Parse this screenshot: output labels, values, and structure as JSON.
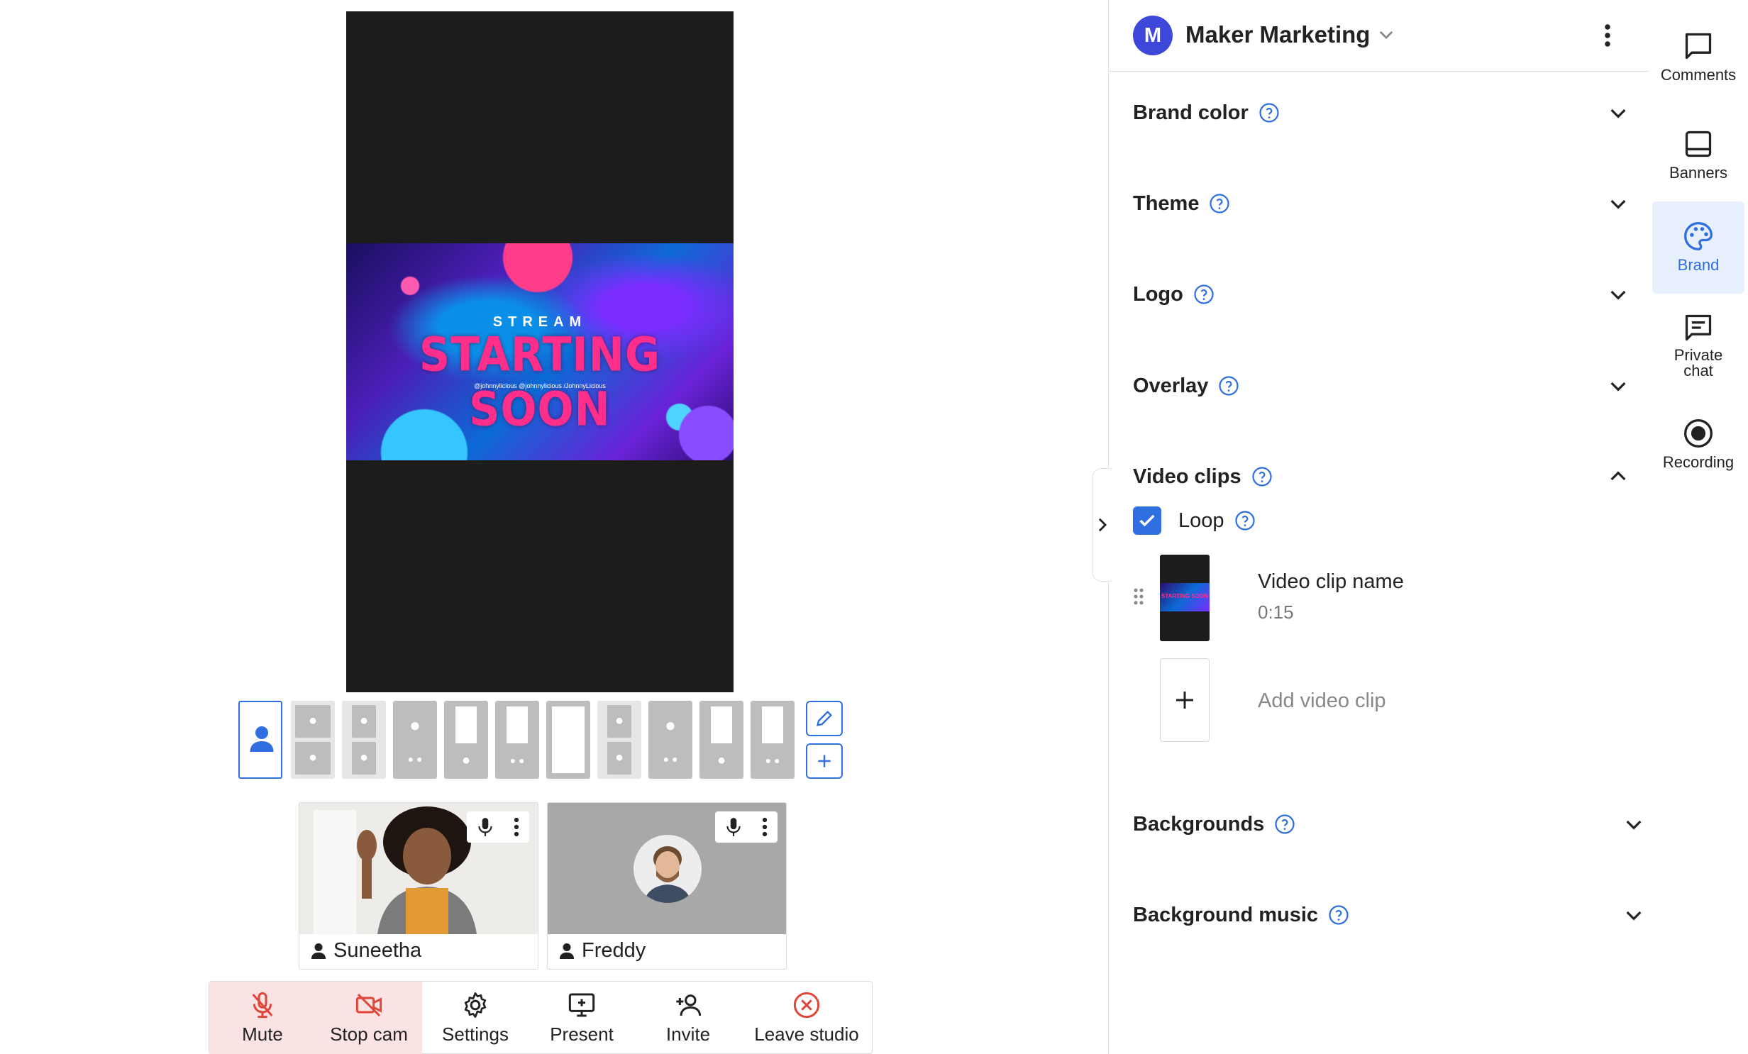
{
  "stage": {
    "banner_small": "STREAM",
    "banner_big": "STARTING SOON",
    "banner_handles": "@johnnylicious   @johnnylicious   /JohnnyLicious"
  },
  "participants": [
    {
      "name": "Suneetha"
    },
    {
      "name": "Freddy"
    }
  ],
  "controls": {
    "mute": "Mute",
    "stop_cam": "Stop cam",
    "settings": "Settings",
    "present": "Present",
    "invite": "Invite",
    "leave": "Leave studio"
  },
  "panel": {
    "brand_initial": "M",
    "brand_name": "Maker Marketing",
    "sections": {
      "brand_color": "Brand color",
      "theme": "Theme",
      "logo": "Logo",
      "overlay": "Overlay",
      "video_clips": "Video clips",
      "backgrounds": "Backgrounds",
      "background_music": "Background music"
    },
    "loop_label": "Loop",
    "clip": {
      "name": "Video clip name",
      "duration": "0:15",
      "thumb_text": "STARTING SOON"
    },
    "add_clip_label": "Add video clip"
  },
  "sidebar": {
    "comments": "Comments",
    "banners": "Banners",
    "brand": "Brand",
    "private_chat": "Private chat",
    "recording": "Recording"
  },
  "colors": {
    "accent": "#2f6fe0",
    "brand_avatar": "#3d47d9",
    "danger": "#e0453a",
    "danger_bg": "#fbe3e3",
    "banner_pink": "#ff2e8a"
  }
}
